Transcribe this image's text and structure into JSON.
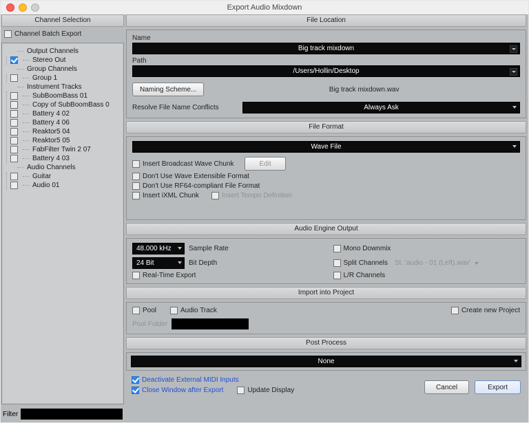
{
  "window": {
    "title": "Export Audio Mixdown"
  },
  "sidebar": {
    "header": "Channel Selection",
    "batch_export_label": "Channel Batch Export",
    "batch_export_checked": false,
    "tree": {
      "output_channels": {
        "label": "Output Channels",
        "children": [
          {
            "label": "Stereo Out",
            "checked": true
          }
        ]
      },
      "group_channels": {
        "label": "Group Channels",
        "children": [
          {
            "label": "Group 1",
            "checked": false
          }
        ]
      },
      "instrument_tracks": {
        "label": "Instrument Tracks",
        "children": [
          {
            "label": "SubBoomBass 01",
            "checked": false
          },
          {
            "label": "Copy of SubBoomBass 0",
            "checked": false
          },
          {
            "label": "Battery 4 02",
            "checked": false
          },
          {
            "label": "Battery 4 06",
            "checked": false
          },
          {
            "label": "Reaktor5 04",
            "checked": false
          },
          {
            "label": "Reaktor5 05",
            "checked": false
          },
          {
            "label": "FabFilter Twin 2 07",
            "checked": false
          },
          {
            "label": "Battery 4 03",
            "checked": false
          }
        ]
      },
      "audio_channels": {
        "label": "Audio Channels",
        "children": [
          {
            "label": "Guitar",
            "checked": false
          },
          {
            "label": "Audio 01",
            "checked": false
          }
        ]
      }
    },
    "filter_label": "Filter"
  },
  "file_location": {
    "header": "File Location",
    "name_label": "Name",
    "name_value": "Big track mixdown",
    "path_label": "Path",
    "path_value": "/Users/Hollin/Desktop",
    "naming_scheme_btn": "Naming Scheme...",
    "preview_filename": "Big track mixdown.wav",
    "resolve_label": "Resolve File Name Conflicts",
    "resolve_value": "Always Ask"
  },
  "file_format": {
    "header": "File Format",
    "format_value": "Wave File",
    "insert_broadcast": "Insert Broadcast Wave Chunk",
    "edit_btn": "Edit",
    "dont_wave_ext": "Don't Use Wave Extensible Format",
    "dont_rf64": "Don't Use RF64-compliant File Format",
    "insert_ixml": "Insert iXML Chunk",
    "insert_tempo": "Insert Tempo Definition"
  },
  "audio_engine": {
    "header": "Audio Engine Output",
    "sample_rate_label": "Sample Rate",
    "sample_rate_value": "48.000 kHz",
    "bit_depth_label": "Bit Depth",
    "bit_depth_value": "24 Bit",
    "real_time_label": "Real-Time Export",
    "mono_label": "Mono Downmix",
    "split_label": "Split Channels",
    "split_value": "St. 'audio - 01 (Left).wav'",
    "lr_label": "L/R Channels"
  },
  "import_project": {
    "header": "Import into Project",
    "pool_label": "Pool",
    "audio_track_label": "Audio Track",
    "create_new_label": "Create new Project",
    "pool_folder_label": "Pool Folder"
  },
  "post_process": {
    "header": "Post Process",
    "value": "None"
  },
  "bottom": {
    "deactivate_midi": "Deactivate External MIDI Inputs",
    "close_after": "Close Window after Export",
    "update_display": "Update Display",
    "cancel": "Cancel",
    "export": "Export"
  }
}
